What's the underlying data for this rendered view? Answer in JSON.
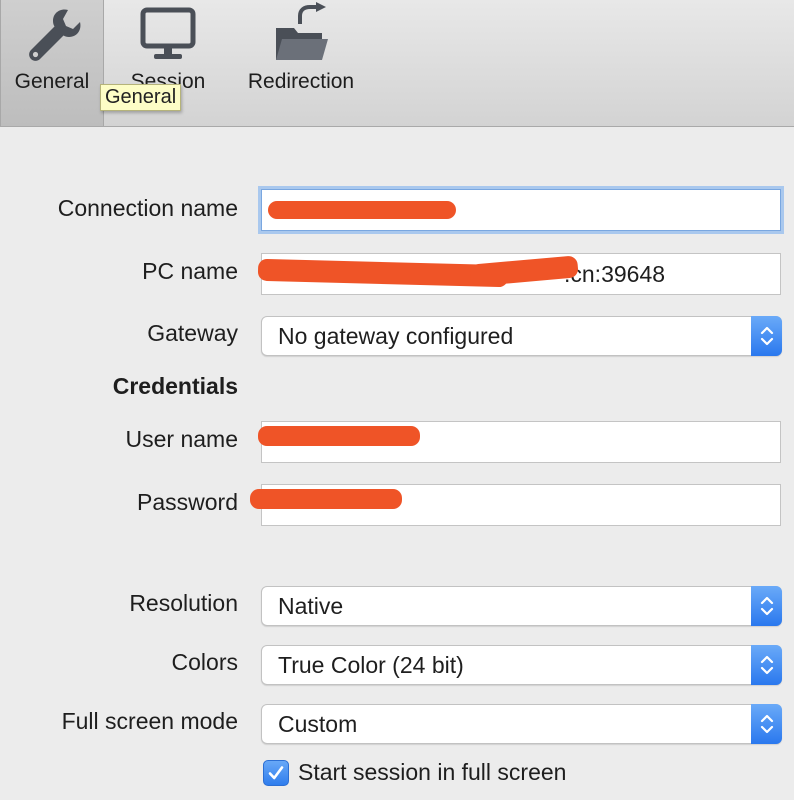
{
  "toolbar": {
    "tabs": [
      {
        "label": "General",
        "icon": "wrench-icon",
        "selected": true
      },
      {
        "label": "Session",
        "icon": "monitor-icon",
        "selected": false
      },
      {
        "label": "Redirection",
        "icon": "folder-redirect-icon",
        "selected": false
      }
    ],
    "tooltip": "General"
  },
  "form": {
    "connection_name": {
      "label": "Connection name",
      "value": ""
    },
    "pc_name": {
      "label": "PC name",
      "value": ".cn:39648"
    },
    "gateway": {
      "label": "Gateway",
      "value": "No gateway configured"
    },
    "credentials_heading": "Credentials",
    "user_name": {
      "label": "User name",
      "value": ""
    },
    "password": {
      "label": "Password",
      "value": ""
    },
    "resolution": {
      "label": "Resolution",
      "value": "Native"
    },
    "colors": {
      "label": "Colors",
      "value": "True Color (24 bit)"
    },
    "full_screen_mode": {
      "label": "Full screen mode",
      "value": "Custom"
    },
    "start_full_screen": {
      "label": "Start session in full screen",
      "checked": true
    }
  },
  "colors": {
    "accent": "#2f7ded",
    "redaction": "#ef5427",
    "tooltip_bg": "#fdfdc6"
  }
}
